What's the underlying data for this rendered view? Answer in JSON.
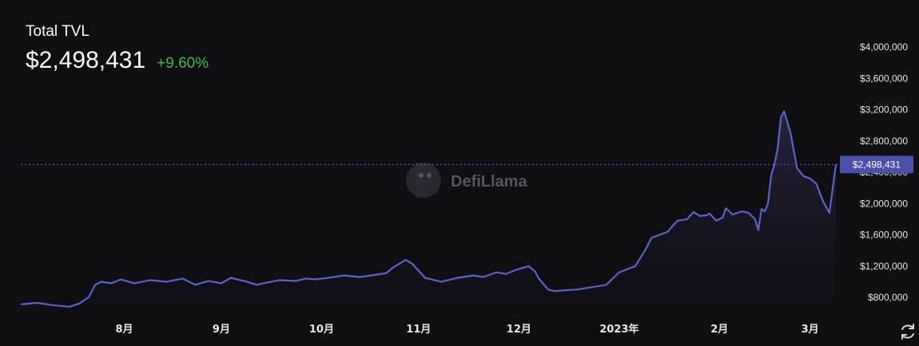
{
  "header": {
    "title": "Total TVL",
    "value": "$2,498,431",
    "change": "+9.60%"
  },
  "watermark": "DefiLlama",
  "refresh_icon": "refresh-icon",
  "colors": {
    "line": "#5a63c8",
    "positive": "#3fb950",
    "background": "#0f0e13",
    "tooltip_bg": "#4b4fa8"
  },
  "chart_data": {
    "type": "area",
    "title": "Total TVL",
    "current_value_label": "$2,498,431",
    "current_value": 2498431,
    "ylim": [
      600000,
      4200000
    ],
    "y_ticks": [
      800000,
      1200000,
      1600000,
      2000000,
      2400000,
      2800000,
      3200000,
      3600000,
      4000000
    ],
    "y_tick_labels": [
      "$800,000",
      "$1,200,000",
      "$1,600,000",
      "$2,000,000",
      "$2,400,000",
      "$2,800,000",
      "$3,200,000",
      "$3,600,000",
      "$4,000,000"
    ],
    "x_tick_labels": [
      "8月",
      "9月",
      "10月",
      "11月",
      "12月",
      "2023年",
      "2月",
      "3月"
    ],
    "x_tick_index": [
      32,
      62,
      93,
      123,
      154,
      185,
      216,
      244
    ],
    "x_range": [
      0,
      252
    ],
    "x": [
      0,
      5,
      10,
      15,
      18,
      21,
      23,
      25,
      28,
      31,
      35,
      40,
      45,
      50,
      52,
      54,
      58,
      62,
      65,
      70,
      73,
      76,
      80,
      85,
      88,
      91,
      95,
      100,
      105,
      110,
      113,
      115,
      117,
      119,
      121,
      125,
      130,
      135,
      140,
      143,
      147,
      150,
      153,
      157,
      159,
      160,
      163,
      165,
      168,
      172,
      175,
      178,
      181,
      185,
      190,
      193,
      195,
      200,
      203,
      206,
      208,
      210,
      212,
      213,
      215,
      217,
      218,
      220,
      223,
      225,
      227,
      228,
      229,
      230,
      231,
      232,
      233,
      234,
      235,
      236,
      238,
      240,
      242,
      244,
      246,
      248,
      250,
      252
    ],
    "y": [
      710000,
      730000,
      700000,
      680000,
      720000,
      800000,
      960000,
      1000000,
      980000,
      1030000,
      980000,
      1020000,
      1000000,
      1040000,
      1000000,
      960000,
      1010000,
      980000,
      1050000,
      1000000,
      960000,
      990000,
      1020000,
      1010000,
      1040000,
      1030000,
      1050000,
      1080000,
      1060000,
      1090000,
      1110000,
      1180000,
      1230000,
      1280000,
      1230000,
      1050000,
      1000000,
      1050000,
      1080000,
      1060000,
      1120000,
      1100000,
      1150000,
      1200000,
      1130000,
      1050000,
      900000,
      880000,
      890000,
      900000,
      920000,
      940000,
      960000,
      1120000,
      1200000,
      1400000,
      1560000,
      1640000,
      1780000,
      1800000,
      1890000,
      1840000,
      1850000,
      1870000,
      1780000,
      1820000,
      1940000,
      1860000,
      1900000,
      1880000,
      1800000,
      1660000,
      1930000,
      1900000,
      2000000,
      2360000,
      2500000,
      2700000,
      3100000,
      3180000,
      2900000,
      2450000,
      2350000,
      2320000,
      2250000,
      2030000,
      1880000,
      2498431
    ]
  }
}
